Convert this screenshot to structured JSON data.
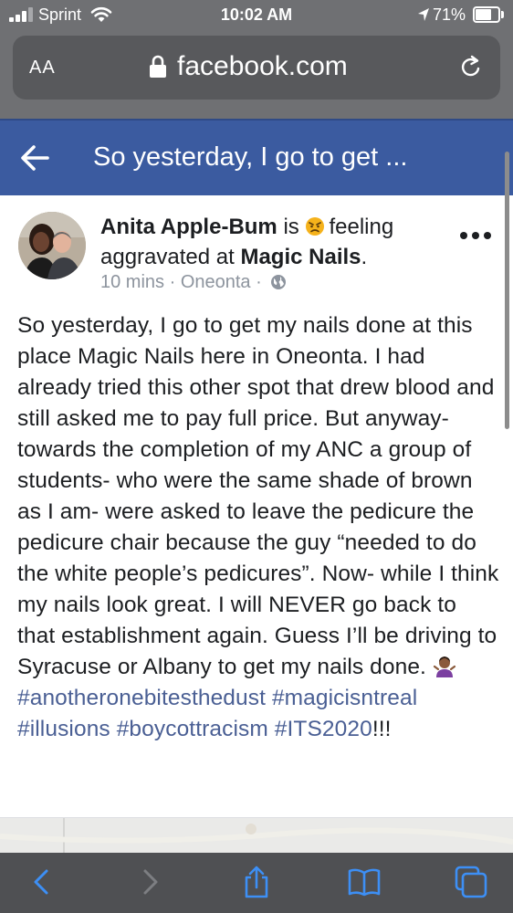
{
  "status_bar": {
    "carrier": "Sprint",
    "time": "10:02 AM",
    "battery_percent": "71%",
    "battery_level": 0.71,
    "icons": [
      "signal-icon",
      "wifi-icon",
      "location-icon",
      "battery-icon"
    ]
  },
  "browser": {
    "text_size_label": "AA",
    "domain": "facebook.com",
    "icons": [
      "lock-icon",
      "reload-icon"
    ]
  },
  "header": {
    "title": "So yesterday, I go to get ...",
    "back_icon": "back-arrow-icon",
    "background_color": "#3b5ba0"
  },
  "post": {
    "author": "Anita Apple-Bum",
    "feeling_prefix": "is",
    "feeling_text": "feeling aggravated at",
    "place": "Magic Nails",
    "place_suffix": ".",
    "time_ago": "10 mins",
    "location": "Oneonta",
    "separator": "·",
    "privacy_icon": "globe-icon",
    "body": "So yesterday, I go to get my nails done at this place Magic Nails here in Oneonta. I had already tried this other spot that drew blood and still asked me to pay full price. But anyway- towards the completion of my ANC a group of students- who were the same shade of brown as I am- were asked to leave the pedicure the pedicure chair because the guy “needed to do the white people’s pedicures”. Now- while I think my nails look great. I will NEVER go back to that establishment again. Guess I’ll be driving to Syracuse or Albany to get my nails done.",
    "hashtags": [
      "#anotheronebitesthedust",
      "#magicisntreal",
      "#illusions",
      "#boycottracism",
      "#ITS2020"
    ],
    "trailing_text": "!!!",
    "hashtag_color": "#4a5f94"
  },
  "toolbar": {
    "icons": [
      "back-icon",
      "forward-icon",
      "share-icon",
      "bookmarks-icon",
      "tabs-icon"
    ]
  }
}
